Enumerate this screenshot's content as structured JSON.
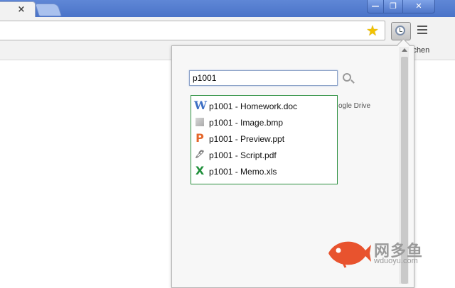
{
  "tab": {
    "close_glyph": "×"
  },
  "window": {
    "min_glyph": "—",
    "max_glyph": "❐",
    "close_glyph": "✕"
  },
  "toolbar": {
    "star_glyph": "★",
    "extension_icon": "clock-icon",
    "menu_icon": "hamburger-menu-icon"
  },
  "bookmarks": {
    "partial_text": "ichen"
  },
  "popup": {
    "search": {
      "value": "p1001",
      "icon": "search-icon"
    },
    "drive_label": "ogle Drive",
    "results": [
      {
        "icon": "word-doc-icon",
        "glyph": "W",
        "label": "p1001 - Homework.doc"
      },
      {
        "icon": "bmp-image-icon",
        "glyph": "",
        "label": "p1001 - Image.bmp"
      },
      {
        "icon": "powerpoint-icon",
        "glyph": "P",
        "label": "p1001 - Preview.ppt"
      },
      {
        "icon": "pdf-script-icon",
        "glyph": "🖊",
        "label": "p1001 - Script.pdf"
      },
      {
        "icon": "excel-icon",
        "glyph": "X",
        "label": "p1001 - Memo.xls"
      }
    ]
  },
  "watermark": {
    "name": "网多鱼",
    "url": "wduoyu.com"
  },
  "colors": {
    "accent_border": "#2b8f3e",
    "titlebar": "#4a73c8"
  }
}
